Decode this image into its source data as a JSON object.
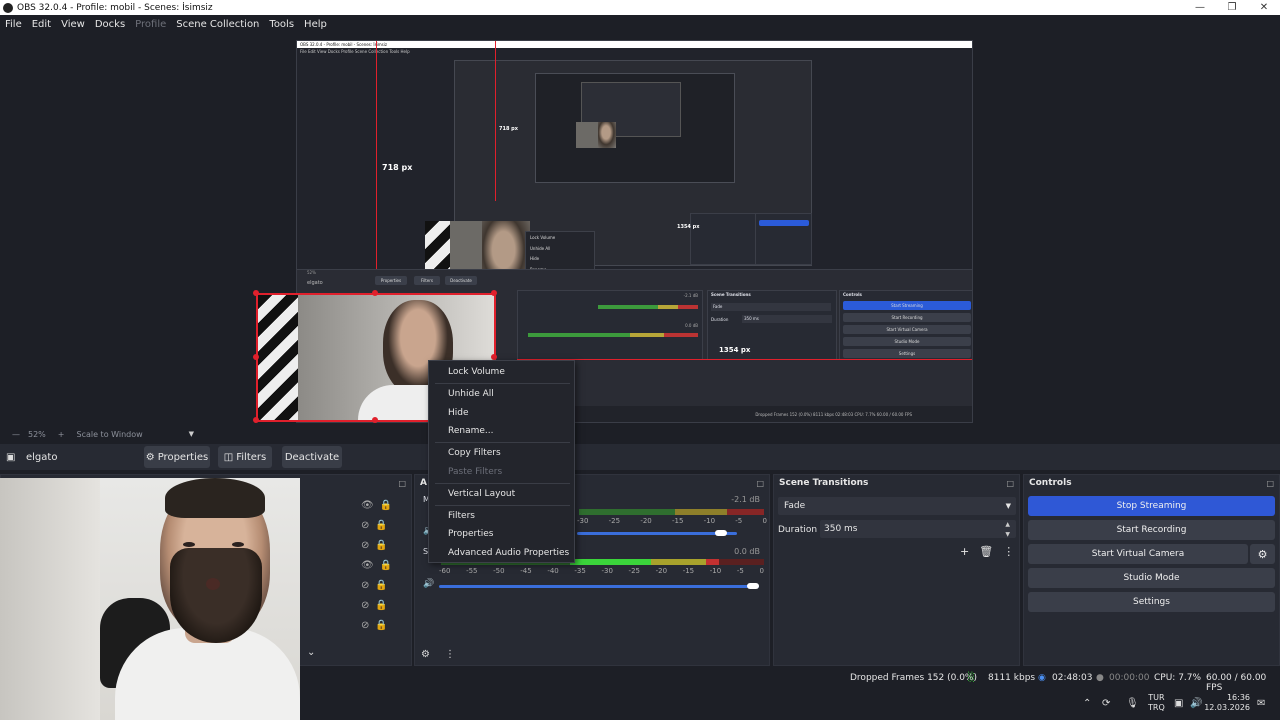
{
  "window": {
    "title": "OBS 32.0.4 - Profile: mobil - Scenes: İsimsiz"
  },
  "menu": [
    "File",
    "Edit",
    "View",
    "Docks",
    "Profile",
    "Scene Collection",
    "Tools",
    "Help"
  ],
  "nested_preview": {
    "title": "OBS 32.0.4 - Profile: mobil - Scenes: İsimsiz",
    "menu": "File  Edit  View  Docks  Profile  Scene Collection  Tools  Help",
    "label_718": "718 px",
    "label_718_small": "718 px",
    "label_1354": "1354 px",
    "label_1354_small": "1354 px",
    "source_name": "elgato",
    "btn_properties": "Properties",
    "btn_filters": "Filters",
    "btn_deactivate": "Deactivate",
    "scene_transitions": "Scene Transitions",
    "controls": "Controls",
    "fade": "Fade",
    "duration": "Duration",
    "duration_val": "350 ms",
    "ctrl_buttons": [
      "Start Streaming",
      "Start Recording",
      "Start Virtual Camera",
      "Studio Mode",
      "Settings"
    ],
    "menu_items": [
      "Lock Volume",
      "Unhide All",
      "Hide",
      "Rename...",
      "Copy Filters",
      "Paste Filters",
      "Vertical Layout",
      "Filters",
      "Properties",
      "Advanced Audio Properties"
    ],
    "zoom": "52%",
    "scale": "Scale to Window",
    "status": "Dropped Frames 152 (0.0%)   8111 kbps   02:48:03   CPU: 7.7%   60.00 / 60.00 FPS",
    "db_top": "-2.1 dB",
    "db_bottom": "0.0 dB"
  },
  "preview_toolbar": {
    "zoom": "52%",
    "plus": "+",
    "scale": "Scale to Window",
    "caret": "▼"
  },
  "source_toolbar": {
    "source": "elgato",
    "properties": "Properties",
    "filters": "Filters",
    "deactivate": "Deactivate"
  },
  "mixer": {
    "header_letter": "A",
    "row1_letter": "M",
    "row2_letter": "S",
    "db1": "-2.1 dB",
    "db2": "0.0 dB",
    "scale_short": [
      "-30",
      "-25",
      "-20",
      "-15",
      "-10",
      "-5",
      "0"
    ],
    "scale_long": [
      "-60",
      "-55",
      "-50",
      "-45",
      "-40",
      "-35",
      "-30",
      "-25",
      "-20",
      "-15",
      "-10",
      "-5",
      "0"
    ],
    "fader1": 0.9,
    "fader2": 0.98
  },
  "scene_transitions": {
    "title": "Scene Transitions",
    "transition": "Fade",
    "duration_label": "Duration",
    "duration_value": "350 ms"
  },
  "controls": {
    "title": "Controls",
    "stop_streaming": "Stop Streaming",
    "start_recording": "Start Recording",
    "start_virtual_camera": "Start Virtual Camera",
    "studio_mode": "Studio Mode",
    "settings": "Settings"
  },
  "context_menu": {
    "lock_volume": "Lock Volume",
    "unhide_all": "Unhide All",
    "hide": "Hide",
    "rename": "Rename...",
    "copy_filters": "Copy Filters",
    "paste_filters": "Paste Filters",
    "vertical_layout": "Vertical Layout",
    "filters": "Filters",
    "properties": "Properties",
    "advanced_audio": "Advanced Audio Properties"
  },
  "status": {
    "dropped": "Dropped Frames 152 (0.0%)",
    "bitrate": "8111 kbps",
    "stream_time": "02:48:03",
    "rec_time": "00:00:00",
    "cpu": "CPU: 7.7%",
    "fps": "60.00 / 60.00 FPS"
  },
  "taskbar": {
    "lang1": "TUR",
    "lang2": "TRQ",
    "time": "16:36",
    "date": "12.03.2026"
  },
  "colors": {
    "accent": "#2f58d6",
    "selection": "#e0202c",
    "background": "#1d1f26",
    "panel": "#272a33"
  }
}
